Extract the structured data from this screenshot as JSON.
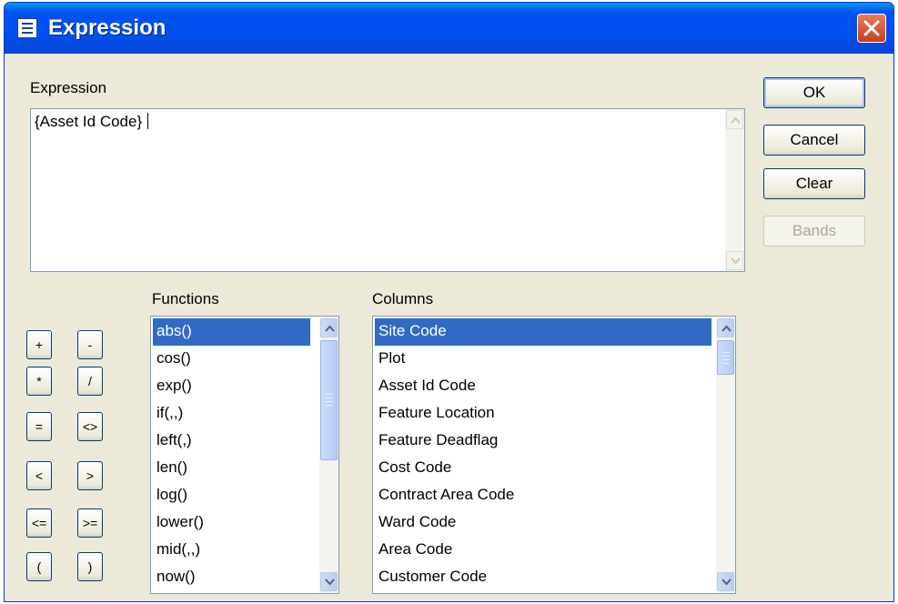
{
  "window": {
    "title": "Expression",
    "close_label": "×"
  },
  "expression": {
    "label": "Expression",
    "value": "{Asset Id Code}"
  },
  "buttons": {
    "ok": "OK",
    "cancel": "Cancel",
    "clear": "Clear",
    "bands": "Bands"
  },
  "operators": [
    "+",
    "-",
    "*",
    "/",
    "=",
    "<>",
    "<",
    ">",
    "<=",
    ">=",
    "(",
    ")"
  ],
  "functions": {
    "label": "Functions",
    "items": [
      "abs()",
      "cos()",
      "exp()",
      "if(,,)",
      "left(,)",
      "len()",
      "log()",
      "lower()",
      "mid(,,)",
      "now()"
    ],
    "selected_index": 0
  },
  "columns": {
    "label": "Columns",
    "items": [
      "Site Code",
      "Plot",
      "Asset Id Code",
      "Feature Location",
      "Feature Deadflag",
      "Cost Code",
      "Contract Area Code",
      "Ward Code",
      "Area Code",
      "Customer Code"
    ],
    "selected_index": 0
  },
  "colors": {
    "titlebar": "#0050ee",
    "dialog_bg": "#ece9d8",
    "selection": "#316ac5",
    "close_button": "#c9401c"
  }
}
